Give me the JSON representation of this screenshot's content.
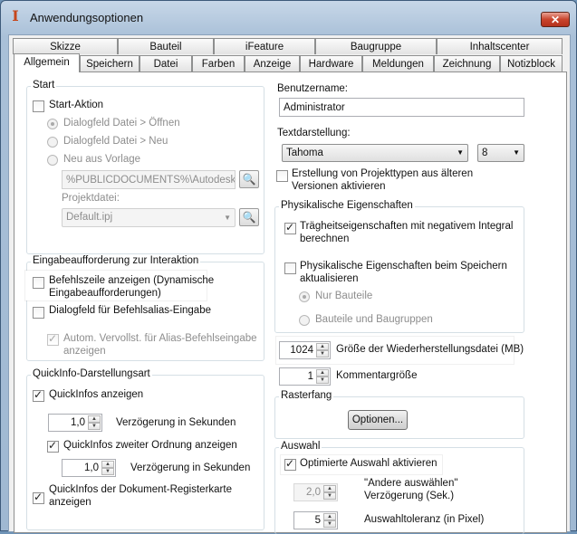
{
  "window": {
    "title": "Anwendungsoptionen",
    "close_glyph": "✕"
  },
  "tabs_top": [
    "Skizze",
    "Bauteil",
    "iFeature",
    "Baugruppe",
    "Inhaltscenter"
  ],
  "tabs_bottom": [
    "Allgemein",
    "Speichern",
    "Datei",
    "Farben",
    "Anzeige",
    "Hardware",
    "Meldungen",
    "Zeichnung",
    "Notizblock"
  ],
  "start": {
    "title": "Start",
    "start_action": "Start-Aktion",
    "radio_open": "Dialogfeld Datei > Öffnen",
    "radio_new": "Dialogfeld Datei > Neu",
    "radio_template": "Neu aus Vorlage",
    "template_path": "%PUBLICDOCUMENTS%\\Autodesk\\Inv",
    "project_label": "Projektdatei:",
    "project_value": "Default.ipj"
  },
  "prompt": {
    "title": "Eingabeaufforderung zur Interaktion",
    "cmdline_1": "Befehlszeile anzeigen (Dynamische",
    "cmdline_2": "Eingabeaufforderungen)",
    "alias_dialog": "Dialogfeld für Befehlsalias-Eingabe",
    "autocomplete_1": "Autom. Vervollst. für Alias-Befehlseingabe",
    "autocomplete_2": "anzeigen"
  },
  "quickinfo": {
    "title": "QuickInfo-Darstellungsart",
    "show": "QuickInfos anzeigen",
    "delay_value": "1,0",
    "delay_label": "Verzögerung in Sekunden",
    "second_show": "QuickInfos zweiter Ordnung anzeigen",
    "second_delay_value": "1,0",
    "second_delay_label": "Verzögerung in Sekunden",
    "doc_tab_1": "QuickInfos der Dokument-Registerkarte",
    "doc_tab_2": "anzeigen"
  },
  "right": {
    "username_label": "Benutzername:",
    "username_value": "Administrator",
    "text_label": "Textdarstellung:",
    "font_value": "Tahoma",
    "size_value": "8",
    "legacy_1": "Erstellung von Projekttypen aus älteren",
    "legacy_2": "Versionen aktivieren",
    "undo_value": "1024",
    "undo_label": "Größe der Wiederherstellungsdatei (MB)",
    "comment_value": "1",
    "comment_label": "Kommentargröße"
  },
  "physical": {
    "title": "Physikalische Eigenschaften",
    "inertia_1": "Trägheitseigenschaften mit negativem Integral",
    "inertia_2": "berechnen",
    "update_1": "Physikalische Eigenschaften beim Speichern",
    "update_2": "aktualisieren",
    "parts_only": "Nur Bauteile",
    "parts_assemblies": "Bauteile und Baugruppen"
  },
  "snap": {
    "title": "Rasterfang",
    "options_button": "Optionen..."
  },
  "selection": {
    "title": "Auswahl",
    "optimized": "Optimierte Auswahl aktivieren",
    "other_value": "2,0",
    "other_label_1": "\"Andere auswählen\"",
    "other_label_2": "Verzögerung (Sek.)",
    "tolerance_value": "5",
    "tolerance_label": "Auswahltoleranz (in Pixel)"
  }
}
